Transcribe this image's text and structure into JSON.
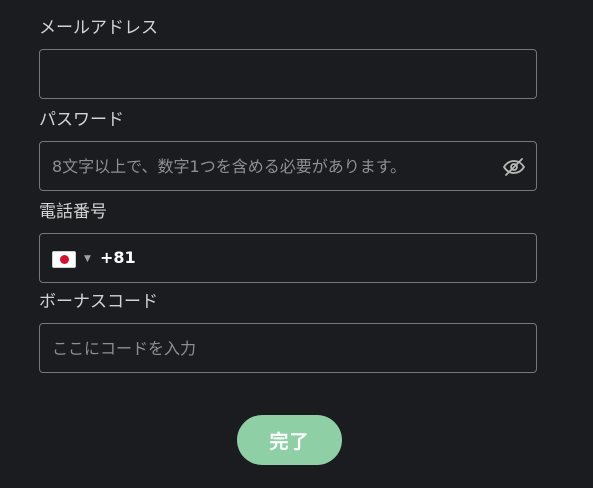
{
  "email": {
    "label": "メールアドレス",
    "value": "",
    "placeholder": ""
  },
  "password": {
    "label": "パスワード",
    "value": "",
    "placeholder": "8文字以上で、数字1つを含める必要があります。",
    "toggle_icon": "eye-off-icon"
  },
  "phone": {
    "label": "電話番号",
    "country_flag": "japan-flag-icon",
    "dial_code": "+81",
    "value": ""
  },
  "bonus_code": {
    "label": "ボーナスコード",
    "value": "",
    "placeholder": "ここにコードを入力"
  },
  "submit": {
    "label": "完了"
  },
  "colors": {
    "background": "#1b1c20",
    "border": "#75767b",
    "submit_bg": "#8ecfa6",
    "flag_red": "#d3102d"
  }
}
